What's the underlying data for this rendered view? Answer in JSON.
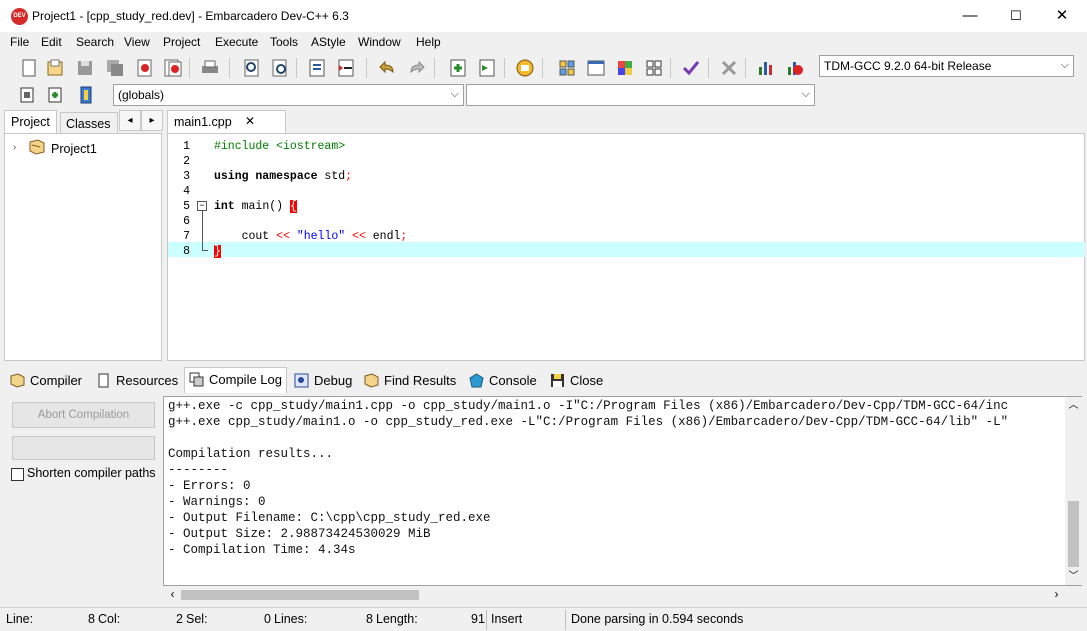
{
  "window": {
    "title": "Project1 - [cpp_study_red.dev] - Embarcadero Dev-C++ 6.3",
    "app_icon_text": "DEV",
    "minimize": "—",
    "maximize": "☐",
    "close": "✕"
  },
  "menu": [
    "File",
    "Edit",
    "Search",
    "View",
    "Project",
    "Execute",
    "Tools",
    "AStyle",
    "Window",
    "Help"
  ],
  "toolbar": {
    "compiler_select": "TDM-GCC 9.2.0 64-bit Release",
    "class_select": "(globals)",
    "member_select": ""
  },
  "left_panel": {
    "tabs": [
      "Project",
      "Classes"
    ],
    "nav_prev": "◂",
    "nav_next": "▸",
    "tree_root": "Project1"
  },
  "editor": {
    "tab": "main1.cpp",
    "tab_close": "✕",
    "lines": [
      {
        "n": "1"
      },
      {
        "n": "2"
      },
      {
        "n": "3"
      },
      {
        "n": "4"
      },
      {
        "n": "5"
      },
      {
        "n": "6"
      },
      {
        "n": "7"
      },
      {
        "n": "8"
      }
    ],
    "code": {
      "l1": "#include <iostream>",
      "l3_kw": "using namespace",
      "l3_rest": " std",
      "l3_semi": ";",
      "l5_kw": "int",
      "l5_rest": " main() ",
      "l5_brace": "{",
      "l7_a": "    cout ",
      "l7_op1": "<<",
      "l7_str": " \"hello\" ",
      "l7_op2": "<<",
      "l7_b": " endl",
      "l7_semi": ";",
      "l8_brace": "}"
    }
  },
  "bottom_tabs": [
    "Compiler",
    "Resources",
    "Compile Log",
    "Debug",
    "Find Results",
    "Console",
    "Close"
  ],
  "compile_panel": {
    "abort_label": "Abort Compilation",
    "shorten_label": "Shorten compiler paths",
    "shorten_checked": false
  },
  "log": [
    "g++.exe -c cpp_study/main1.cpp -o cpp_study/main1.o -I\"C:/Program Files (x86)/Embarcadero/Dev-Cpp/TDM-GCC-64/inc",
    "g++.exe cpp_study/main1.o -o cpp_study_red.exe -L\"C:/Program Files (x86)/Embarcadero/Dev-Cpp/TDM-GCC-64/lib\" -L\"",
    "",
    "Compilation results...",
    "--------",
    "- Errors: 0",
    "- Warnings: 0",
    "- Output Filename: C:\\cpp\\cpp_study_red.exe",
    "- Output Size: 2.98873424530029 MiB",
    "- Compilation Time: 4.34s"
  ],
  "status": {
    "line_label": "Line:",
    "line_val": "8",
    "col_label": "Col:",
    "col_val": "2",
    "sel_label": "Sel:",
    "sel_val": "0",
    "lines_label": "Lines:",
    "lines_val": "8",
    "length_label": "Length:",
    "length_val": "91",
    "mode": "Insert",
    "message": "Done parsing in 0.594 seconds"
  },
  "colors": {
    "accent_red": "#d42a2a",
    "current_line": "#ccffff",
    "log_bg": "#ffffff"
  }
}
